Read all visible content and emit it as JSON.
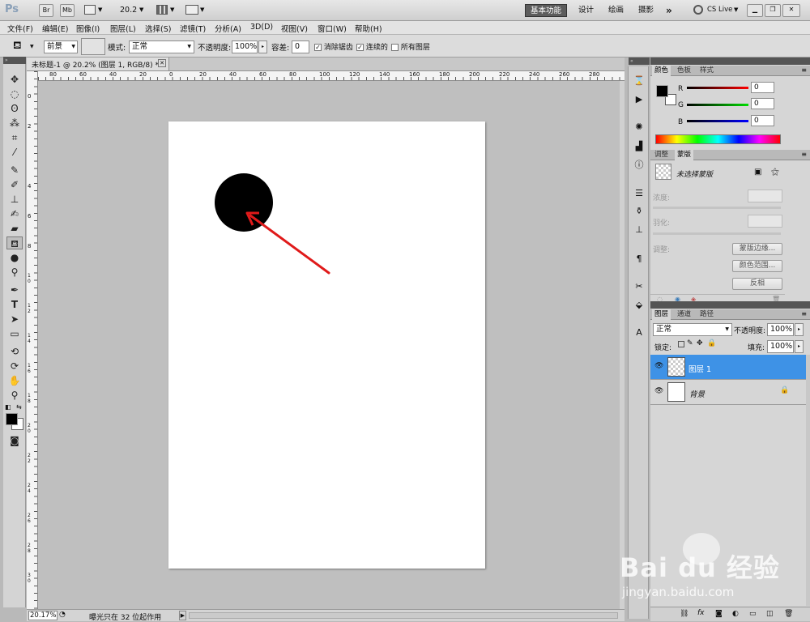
{
  "app": {
    "logo": "Ps",
    "bridge": "Br",
    "mini_bridge": "Mb",
    "zoom_value": "20.2",
    "workspaces": [
      "基本功能",
      "设计",
      "绘画",
      "摄影"
    ],
    "more": "»",
    "cs_live": "CS Live"
  },
  "menu": [
    "文件(F)",
    "编辑(E)",
    "图像(I)",
    "图层(L)",
    "选择(S)",
    "滤镜(T)",
    "分析(A)",
    "3D(D)",
    "视图(V)",
    "窗口(W)",
    "帮助(H)"
  ],
  "options": {
    "fill_source": "前景",
    "mode_label": "模式:",
    "mode_value": "正常",
    "opacity_label": "不透明度:",
    "opacity_value": "100%",
    "tolerance_label": "容差:",
    "tolerance_value": "0",
    "antialias_label": "消除锯齿",
    "antialias_checked": true,
    "contiguous_label": "连续的",
    "contiguous_checked": true,
    "all_layers_label": "所有图层",
    "all_layers_checked": false
  },
  "document": {
    "tab_title": "未标题-1 @ 20.2% (图层 1, RGB/8) *",
    "ruler_labels": [
      "80",
      "60",
      "40",
      "20",
      "0",
      "20",
      "40",
      "60",
      "80",
      "100",
      "120",
      "140",
      "160",
      "180",
      "200",
      "220",
      "240",
      "260",
      "280"
    ],
    "vruler_labels": [
      "0",
      "2",
      "4",
      "6",
      "8",
      "10",
      "12",
      "14",
      "16",
      "18",
      "20",
      "22",
      "24",
      "26",
      "28",
      "30"
    ]
  },
  "status": {
    "zoom": "20.17%",
    "message": "曝光只在 32 位起作用"
  },
  "color_panel": {
    "tabs": [
      "颜色",
      "色板",
      "样式"
    ],
    "r_label": "R",
    "g_label": "G",
    "b_label": "B",
    "r_value": "0",
    "g_value": "0",
    "b_value": "0",
    "foreground": "#000000",
    "background": "#ffffff"
  },
  "masks_panel": {
    "tabs": [
      "调整",
      "蒙版"
    ],
    "no_mask": "未选择蒙版",
    "density": "浓度:",
    "feather": "羽化:",
    "refine": "调整:",
    "mask_edge": "蒙版边缘...",
    "color_range": "颜色范围...",
    "invert": "反相"
  },
  "layers_panel": {
    "tabs": [
      "图层",
      "通道",
      "路径"
    ],
    "blend_mode": "正常",
    "opacity_label": "不透明度:",
    "opacity_value": "100%",
    "lock_label": "锁定:",
    "fill_label": "填充:",
    "fill_value": "100%",
    "layers": [
      {
        "name": "图层 1",
        "selected": true
      },
      {
        "name": "背景",
        "selected": false
      }
    ]
  },
  "watermark": {
    "brand": "Bai du 经验",
    "url": "jingyan.baidu.com"
  }
}
